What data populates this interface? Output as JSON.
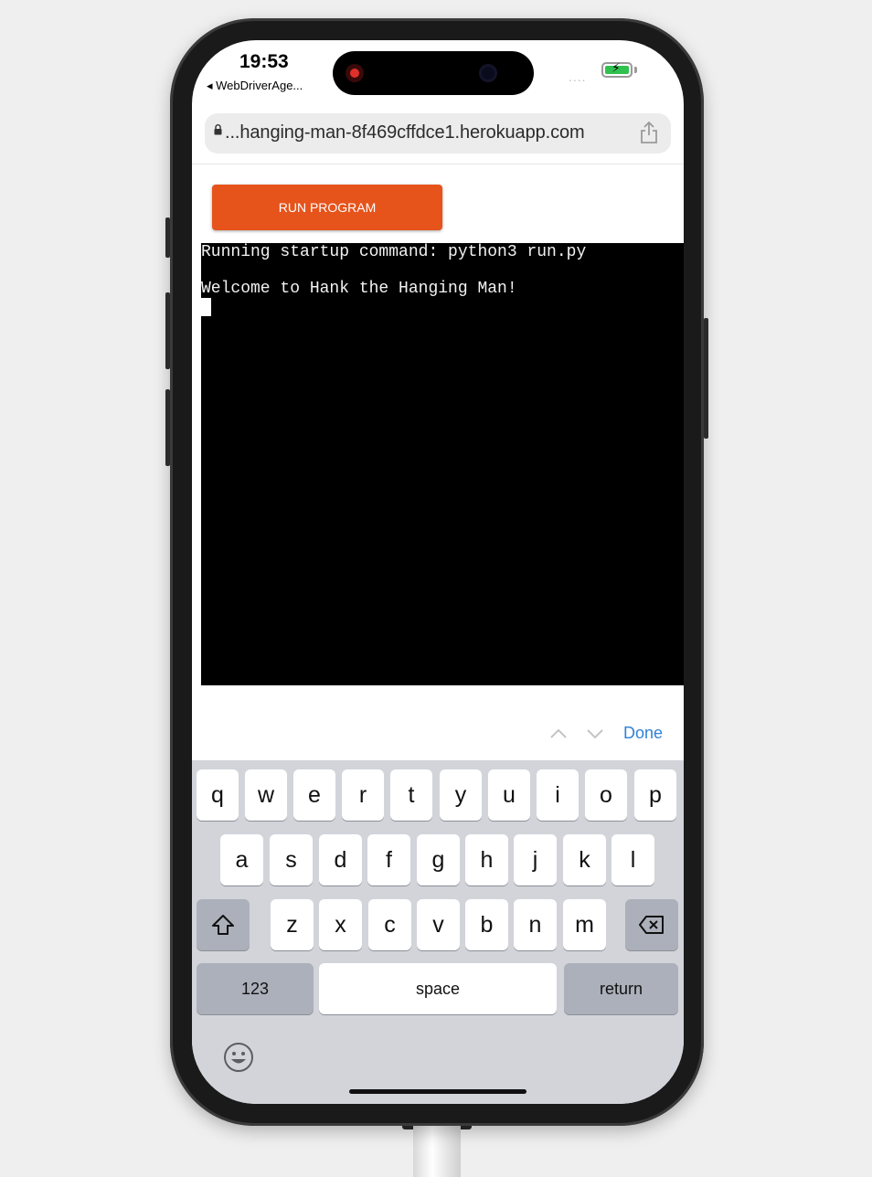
{
  "status_bar": {
    "time": "19:53",
    "back_app": "◂ WebDriverAge...",
    "signal": "....",
    "battery_color": "#30c150"
  },
  "browser": {
    "url": "...hanging-man-8f469cffdce1.herokuapp.com",
    "lock_icon": "lock-icon",
    "share_icon": "share-icon"
  },
  "page": {
    "run_button_label": "RUN PROGRAM",
    "run_button_color": "#e6531b"
  },
  "terminal": {
    "lines": [
      "Running startup command: python3 run.py",
      "Welcome to Hank the Hanging Man!"
    ]
  },
  "accessory_bar": {
    "done_label": "Done",
    "done_color": "#2f82d6"
  },
  "keyboard": {
    "row1": [
      "q",
      "w",
      "e",
      "r",
      "t",
      "y",
      "u",
      "i",
      "o",
      "p"
    ],
    "row2": [
      "a",
      "s",
      "d",
      "f",
      "g",
      "h",
      "j",
      "k",
      "l"
    ],
    "row3": [
      "z",
      "x",
      "c",
      "v",
      "b",
      "n",
      "m"
    ],
    "numbers_label": "123",
    "space_label": "space",
    "return_label": "return",
    "emoji_icon": "emoji-icon"
  }
}
